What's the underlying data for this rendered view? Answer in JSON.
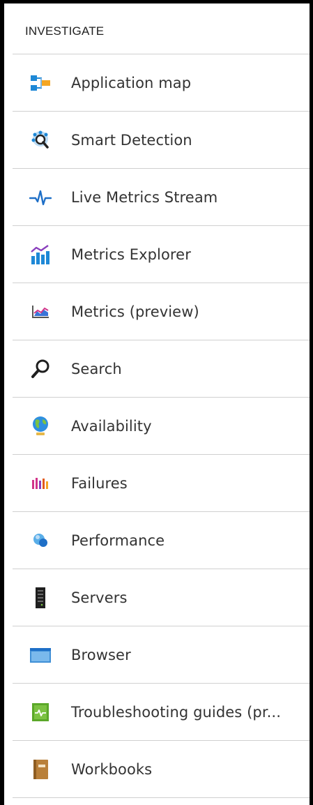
{
  "section": {
    "title": "INVESTIGATE"
  },
  "items": [
    {
      "label": "Application map",
      "icon": "application-map-icon"
    },
    {
      "label": "Smart Detection",
      "icon": "smart-detection-icon"
    },
    {
      "label": "Live Metrics Stream",
      "icon": "live-metrics-icon"
    },
    {
      "label": "Metrics Explorer",
      "icon": "metrics-explorer-icon"
    },
    {
      "label": "Metrics (preview)",
      "icon": "metrics-preview-icon"
    },
    {
      "label": "Search",
      "icon": "search-icon"
    },
    {
      "label": "Availability",
      "icon": "globe-icon"
    },
    {
      "label": "Failures",
      "icon": "failures-icon"
    },
    {
      "label": "Performance",
      "icon": "performance-icon"
    },
    {
      "label": "Servers",
      "icon": "server-icon"
    },
    {
      "label": "Browser",
      "icon": "browser-icon"
    },
    {
      "label": "Troubleshooting guides (pr...",
      "icon": "troubleshooting-guide-icon"
    },
    {
      "label": "Workbooks",
      "icon": "workbook-icon"
    }
  ]
}
